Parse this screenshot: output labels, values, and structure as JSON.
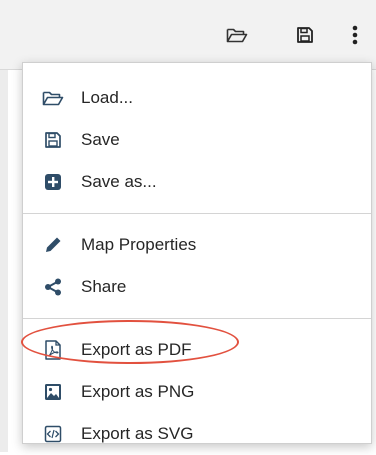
{
  "toolbar": {
    "open_icon": "folder-open-icon",
    "save_icon": "floppy-disk-icon",
    "more_icon": "more-vertical-icon"
  },
  "menu": {
    "items": [
      {
        "label": "Load...",
        "icon": "folder-open-icon"
      },
      {
        "label": "Save",
        "icon": "floppy-disk-icon"
      },
      {
        "label": "Save as...",
        "icon": "plus-square-icon"
      },
      {
        "label": "Map Properties",
        "icon": "pencil-icon"
      },
      {
        "label": "Share",
        "icon": "share-icon"
      },
      {
        "label": "Export as PDF",
        "icon": "pdf-file-icon"
      },
      {
        "label": "Export as PNG",
        "icon": "image-file-icon"
      },
      {
        "label": "Export as SVG",
        "icon": "code-file-icon"
      }
    ]
  },
  "colors": {
    "highlight": "#e2513f",
    "icon": "#2f4d68"
  }
}
